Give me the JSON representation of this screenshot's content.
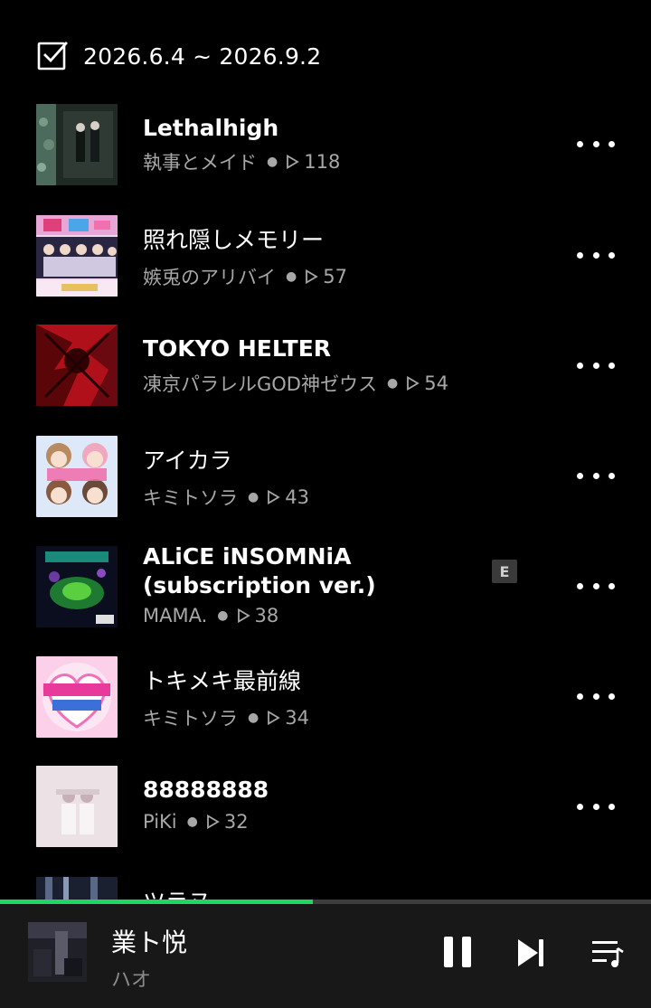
{
  "header": {
    "icon": "checkbox-icon",
    "date_range": "2026.6.4 ~ 2026.9.2"
  },
  "tracks": [
    {
      "title": "Lethalhigh",
      "artist": "執事とメイド",
      "plays": "118"
    },
    {
      "title": "照れ隠しメモリー",
      "artist": "嫉兎のアリバイ",
      "plays": "57"
    },
    {
      "title": "TOKYO HELTER",
      "artist": "凍京パラレルGOD神ゼウス",
      "plays": "54"
    },
    {
      "title": "アイカラ",
      "artist": "キミトソラ",
      "plays": "43"
    },
    {
      "title": "ALiCE iNSOMNiA (subscription ver.)",
      "artist": "MAMA.",
      "plays": "38",
      "explicit": "E"
    },
    {
      "title": "トキメキ最前線",
      "artist": "キミトソラ",
      "plays": "34"
    },
    {
      "title": "88888888",
      "artist": "PiKi",
      "plays": "32"
    },
    {
      "title": "ツラヌ",
      "artist": "",
      "plays": ""
    }
  ],
  "now_playing": {
    "title": "業ト悦",
    "artist": "ハオ",
    "progress": 0.48,
    "icons": [
      "pause-icon",
      "skip-next-icon",
      "queue-icon"
    ]
  },
  "colors": {
    "background": "#000000",
    "accent": "#1ed760",
    "subtext": "#a7a7a7",
    "player_bg": "#181818"
  }
}
